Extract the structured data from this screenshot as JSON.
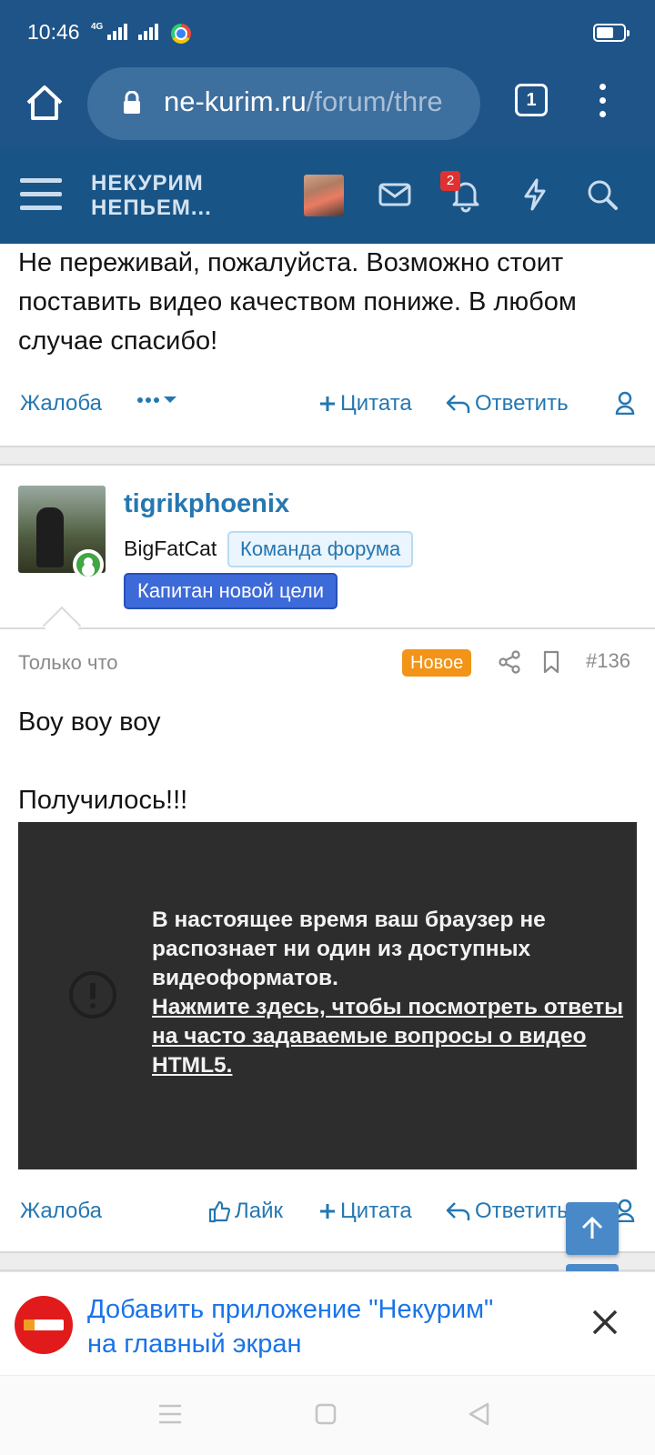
{
  "status_bar": {
    "time": "10:46",
    "network_tag": "4G"
  },
  "browser": {
    "url_domain": "ne-kurim.ru",
    "url_path": "/forum/thre",
    "tab_count": "1"
  },
  "forum_header": {
    "logo_line1": "НЕКУРИМ",
    "logo_line2": "НЕПЬЕМ...",
    "notification_count": "2"
  },
  "previous_post": {
    "text": "Не переживай, пожалуйста. Возможно стоит поставить видео качеством пониже. В любом случае спасибо!",
    "actions": {
      "report": "Жалоба",
      "quote": "Цитата",
      "reply": "Ответить"
    }
  },
  "post": {
    "username": "tigrikphoenix",
    "user_title": "BigFatCat",
    "badge_team": "Команда форума",
    "badge_goal": "Капитан новой цели",
    "time": "Только что",
    "new_badge": "Новое",
    "number": "#136",
    "body_line1": "Воу воу воу",
    "body_line2": "Получилось!!!",
    "video_message": "В настоящее время ваш браузер не распознает ни один из доступных видеоформатов.",
    "video_link": "Нажмите здесь, чтобы посмотреть ответы на часто задаваемые вопросы о видео HTML5.",
    "actions": {
      "report": "Жалоба",
      "like": "Лайк",
      "quote": "Цитата",
      "reply": "Ответить"
    }
  },
  "install_banner": {
    "line1": "Добавить приложение \"Некурим\"",
    "line2": "на главный экран"
  },
  "colors": {
    "header_blue": "#185486",
    "link_blue": "#2577b1",
    "new_badge": "#f29418",
    "goal_badge": "#3d6ad9",
    "banner_link": "#1a73e8"
  }
}
